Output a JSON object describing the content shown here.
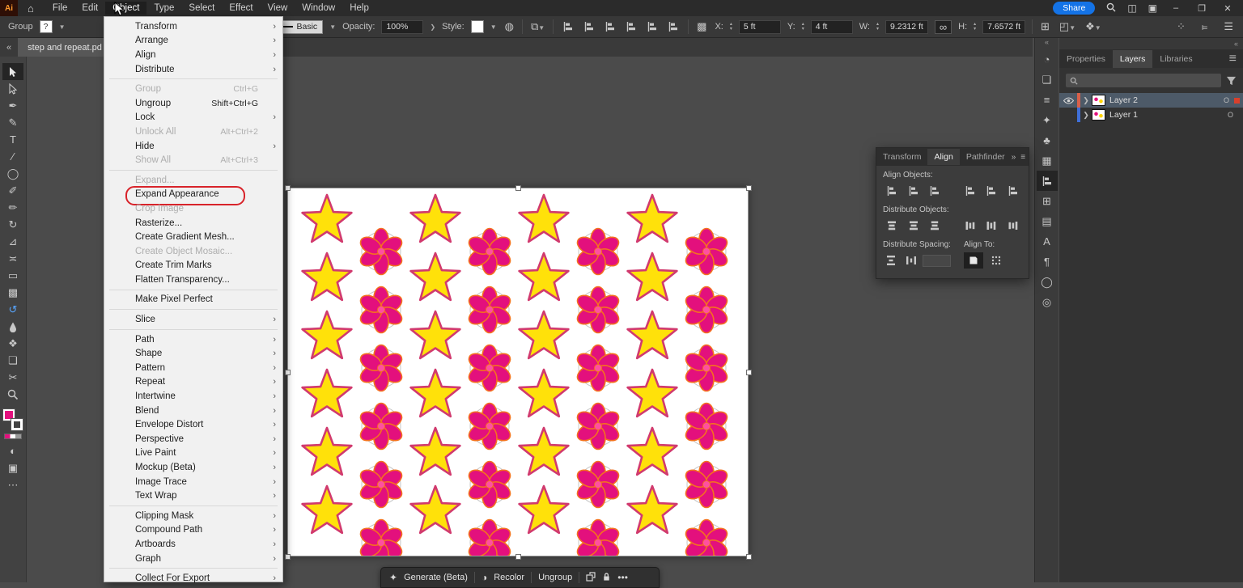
{
  "titlebar": {
    "logo": "Ai",
    "menus": [
      "File",
      "Edit",
      "Object",
      "Type",
      "Select",
      "Effect",
      "View",
      "Window",
      "Help"
    ],
    "active_menu": "Object",
    "share_label": "Share",
    "window_controls": {
      "minimize": "–",
      "restore": "❐",
      "close": "✕"
    }
  },
  "controlbar": {
    "selection_label": "Group",
    "fill_proxy": "?",
    "stroke_style": "Basic",
    "opacity_label": "Opacity:",
    "opacity_value": "100%",
    "style_label": "Style:",
    "x_label": "X:",
    "x_value": "5 ft",
    "y_label": "Y:",
    "y_value": "4 ft",
    "w_label": "W:",
    "w_value": "9.2312 ft",
    "h_label": "H:",
    "h_value": "7.6572 ft",
    "link_icon_glyph": "∞"
  },
  "tabstrip": {
    "overflow_glyph": "«",
    "document_title": "step and repeat.pd"
  },
  "toolbar": {
    "tools": [
      {
        "name": "selection-tool",
        "glyph": "svg-cursor",
        "active": true
      },
      {
        "name": "direct-selection-tool",
        "glyph": "svg-cursor-hollow"
      },
      {
        "name": "pen-tool",
        "glyph": "✒"
      },
      {
        "name": "curvature-tool",
        "glyph": "✎"
      },
      {
        "name": "type-tool",
        "glyph": "T"
      },
      {
        "name": "line-segment-tool",
        "glyph": "∕"
      },
      {
        "name": "ellipse-tool",
        "glyph": "◯"
      },
      {
        "name": "paintbrush-tool",
        "glyph": "✐"
      },
      {
        "name": "pencil-tool",
        "glyph": "✏"
      },
      {
        "name": "rotate-tool",
        "glyph": "↻"
      },
      {
        "name": "scale-tool",
        "glyph": "⊿"
      },
      {
        "name": "width-tool",
        "glyph": "≍"
      },
      {
        "name": "free-transform-tool",
        "glyph": "▭"
      },
      {
        "name": "gradient-tool",
        "glyph": "▩"
      },
      {
        "name": "rotate-view-tool",
        "glyph": "↺",
        "color": "#58a6ff"
      },
      {
        "name": "eyedropper-tool",
        "glyph": "svg-dropper"
      },
      {
        "name": "blend-tool",
        "glyph": "❖"
      },
      {
        "name": "artboard-tool",
        "glyph": "❏"
      },
      {
        "name": "slice-tool",
        "glyph": "✂"
      },
      {
        "name": "zoom-tool",
        "glyph": "svg-zoom"
      }
    ],
    "more_glyph": "⋯"
  },
  "object_menu": {
    "items": [
      {
        "label": "Transform",
        "sub": true
      },
      {
        "label": "Arrange",
        "sub": true
      },
      {
        "label": "Align",
        "sub": true
      },
      {
        "label": "Distribute",
        "sub": true
      },
      {
        "sep": true
      },
      {
        "label": "Group",
        "shortcut": "Ctrl+G",
        "disabled": true
      },
      {
        "label": "Ungroup",
        "shortcut": "Shift+Ctrl+G"
      },
      {
        "label": "Lock",
        "sub": true
      },
      {
        "label": "Unlock All",
        "shortcut": "Alt+Ctrl+2",
        "disabled": true
      },
      {
        "label": "Hide",
        "sub": true
      },
      {
        "label": "Show All",
        "shortcut": "Alt+Ctrl+3",
        "disabled": true
      },
      {
        "sep": true
      },
      {
        "label": "Expand...",
        "disabled": true
      },
      {
        "label": "Expand Appearance",
        "annotated": true
      },
      {
        "label": "Crop Image",
        "disabled": true
      },
      {
        "label": "Rasterize..."
      },
      {
        "label": "Create Gradient Mesh..."
      },
      {
        "label": "Create Object Mosaic...",
        "disabled": true
      },
      {
        "label": "Create Trim Marks"
      },
      {
        "label": "Flatten Transparency..."
      },
      {
        "sep": true
      },
      {
        "label": "Make Pixel Perfect"
      },
      {
        "sep": true
      },
      {
        "label": "Slice",
        "sub": true
      },
      {
        "sep": true
      },
      {
        "label": "Path",
        "sub": true
      },
      {
        "label": "Shape",
        "sub": true
      },
      {
        "label": "Pattern",
        "sub": true
      },
      {
        "label": "Repeat",
        "sub": true
      },
      {
        "label": "Intertwine",
        "sub": true
      },
      {
        "label": "Blend",
        "sub": true
      },
      {
        "label": "Envelope Distort",
        "sub": true
      },
      {
        "label": "Perspective",
        "sub": true
      },
      {
        "label": "Live Paint",
        "sub": true
      },
      {
        "label": "Mockup (Beta)",
        "sub": true
      },
      {
        "label": "Image Trace",
        "sub": true
      },
      {
        "label": "Text Wrap",
        "sub": true
      },
      {
        "sep": true
      },
      {
        "label": "Clipping Mask",
        "sub": true
      },
      {
        "label": "Compound Path",
        "sub": true
      },
      {
        "label": "Artboards",
        "sub": true
      },
      {
        "label": "Graph",
        "sub": true
      },
      {
        "sep": true
      },
      {
        "label": "Collect For Export",
        "sub": true
      }
    ]
  },
  "align_panel": {
    "tabs": [
      "Transform",
      "Align",
      "Pathfinder"
    ],
    "active_tab": "Align",
    "collapse_glyph": "»",
    "menu_glyph": "≡",
    "align_objects_label": "Align Objects:",
    "align_objects": [
      "h-left",
      "h-center",
      "h-right",
      "v-top",
      "v-center",
      "v-bottom"
    ],
    "distribute_objects_label": "Distribute Objects:",
    "distribute_objects": [
      "d-top",
      "d-vcenter",
      "d-bottom",
      "d-left",
      "d-hcenter",
      "d-right"
    ],
    "distribute_spacing_label": "Distribute Spacing:",
    "distribute_spacing": [
      "spacing-v",
      "spacing-h"
    ],
    "align_to_label": "Align To:",
    "align_to": [
      {
        "name": "alignto-artboard",
        "selected": true
      },
      {
        "name": "alignto-key"
      }
    ]
  },
  "icon_dock": {
    "collapse_glyph": "«",
    "icons": [
      {
        "name": "color-wheel",
        "glyph": "◔"
      },
      {
        "name": "artboards-panel",
        "glyph": "❏"
      },
      {
        "name": "stroke-panel",
        "glyph": "≡"
      },
      {
        "name": "brushes-panel",
        "glyph": "✦"
      },
      {
        "name": "symbols-panel",
        "glyph": "♣"
      },
      {
        "name": "pattern-options-panel",
        "glyph": "▦"
      },
      {
        "name": "align-panel",
        "glyph": "svg-align",
        "active": true
      },
      {
        "name": "transform-panel",
        "glyph": "⊞"
      },
      {
        "name": "gradient-panel",
        "glyph": "▤"
      },
      {
        "name": "character-panel",
        "glyph": "A"
      },
      {
        "name": "paragraph-panel",
        "glyph": "¶"
      },
      {
        "name": "appearance-panel",
        "glyph": "◯"
      },
      {
        "name": "graphic-styles-panel",
        "glyph": "◎"
      }
    ]
  },
  "panel_dock": {
    "collapse_glyph": "«",
    "tabs": [
      "Properties",
      "Layers",
      "Libraries"
    ],
    "active_tab": "Layers",
    "menu_glyph": "≡",
    "search_placeholder": "",
    "layers": [
      {
        "name": "Layer 2",
        "selected": true,
        "visible": true,
        "color": "#d8604a",
        "has_selection_chip": true,
        "target": "O"
      },
      {
        "name": "Layer 1",
        "selected": false,
        "visible": false,
        "color": "#3f6fd8",
        "has_selection_chip": false,
        "target": "O"
      }
    ]
  },
  "bottom_bar": {
    "generate_label": "Generate (Beta)",
    "generate_glyph": "✦",
    "recolor_label": "Recolor",
    "recolor_glyph": "◑",
    "ungroup_label": "Ungroup",
    "more_glyph": "•••"
  },
  "artboard_pattern": {
    "description": "staggered grid, alternating columns of stars and 6-petal flowers",
    "star_columns": 4,
    "flower_columns": 4,
    "rows": 6,
    "star": {
      "fill": "#ffe10a",
      "stroke": "#d13a6e"
    },
    "flower": {
      "petal_fill": "#e3107d",
      "petal_stroke": "#f4711f",
      "ring": "#c6c6c6",
      "center": "#ff4fa0"
    }
  }
}
